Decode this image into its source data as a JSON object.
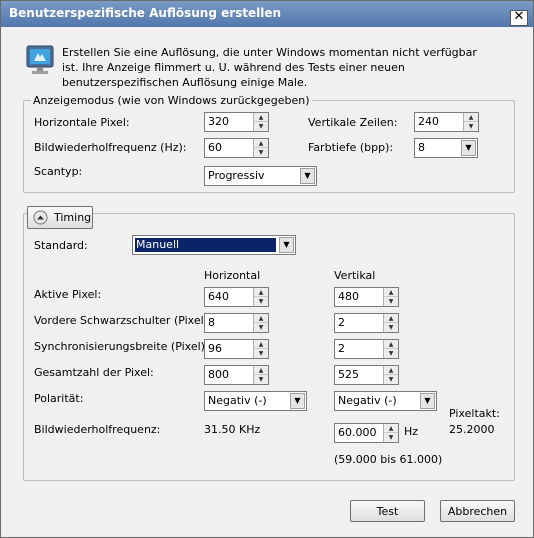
{
  "window": {
    "title": "Benutzerspezifische Auflösung erstellen",
    "close_symbol": "✕"
  },
  "intro": {
    "text": "Erstellen Sie eine Auflösung, die unter Windows momentan nicht verfügbar ist. Ihre Anzeige flimmert u. U. während des Tests einer neuen benutzerspezifischen Auflösung einige Male."
  },
  "display_mode": {
    "legend": "Anzeigemodus (wie von Windows zurückgegeben)",
    "h_pixels_label": "Horizontale Pixel:",
    "h_pixels_value": "320",
    "v_lines_label": "Vertikale Zeilen:",
    "v_lines_value": "240",
    "refresh_label": "Bildwiederholfrequenz (Hz):",
    "refresh_value": "60",
    "color_depth_label": "Farbtiefe (bpp):",
    "color_depth_value": "8",
    "scan_label": "Scantyp:",
    "scan_value": "Progressiv"
  },
  "timing": {
    "button_label": "Timing",
    "standard_label": "Standard:",
    "standard_value": "Manuell",
    "col_horizontal": "Horizontal",
    "col_vertical": "Vertikal",
    "active_label": "Aktive Pixel:",
    "active_h": "640",
    "active_v": "480",
    "porch_label": "Vordere Schwarzschulter (Pixel):",
    "porch_h": "8",
    "porch_v": "2",
    "sync_label": "Synchronisierungsbreite (Pixel):",
    "sync_h": "96",
    "sync_v": "2",
    "total_label": "Gesamtzahl der Pixel:",
    "total_h": "800",
    "total_v": "525",
    "polarity_label": "Polarität:",
    "polarity_h": "Negativ (-)",
    "polarity_v": "Negativ (-)",
    "refresh_label": "Bildwiederholfrequenz:",
    "refresh_h": "31.50 KHz",
    "refresh_v": "60.000",
    "refresh_unit": "Hz",
    "refresh_range": "(59.000 bis 61.000)",
    "pixelclock_label": "Pixeltakt:",
    "pixelclock_value": "25.2000"
  },
  "buttons": {
    "test": "Test",
    "cancel": "Abbrechen"
  }
}
